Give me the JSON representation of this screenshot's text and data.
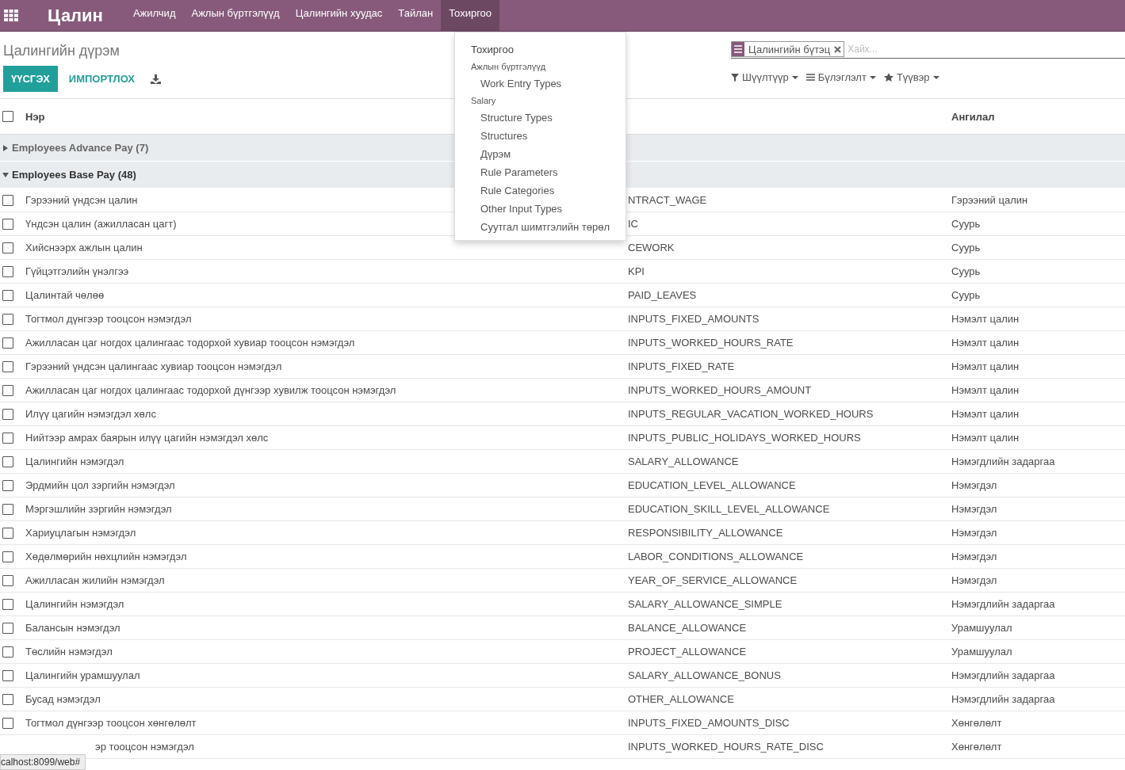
{
  "app_title": "Цалин",
  "nav": [
    {
      "label": "Ажилчид",
      "selected": false
    },
    {
      "label": "Ажлын бүртгэлүүд",
      "selected": false
    },
    {
      "label": "Цалингийн хуудас",
      "selected": false
    },
    {
      "label": "Тайлан",
      "selected": false
    },
    {
      "label": "Тохиргоо",
      "selected": true
    }
  ],
  "menu": [
    {
      "kind": "top",
      "label": "Тохиргоо"
    },
    {
      "kind": "section",
      "label": "Ажлын бүртгэлүүд"
    },
    {
      "kind": "item",
      "label": "Work Entry Types"
    },
    {
      "kind": "section",
      "label": "Salary"
    },
    {
      "kind": "item",
      "label": "Structure Types"
    },
    {
      "kind": "item",
      "label": "Structures"
    },
    {
      "kind": "item",
      "label": "Дүрэм"
    },
    {
      "kind": "item",
      "label": "Rule Parameters"
    },
    {
      "kind": "item",
      "label": "Rule Categories"
    },
    {
      "kind": "item",
      "label": "Other Input Types"
    },
    {
      "kind": "item",
      "label": "Суутгал шимтгэлийн төрөл"
    }
  ],
  "page_title": "Цалингийн дүрэм",
  "buttons": {
    "create": "ҮҮСГЭХ",
    "import": "ИМПОРТЛОХ"
  },
  "search": {
    "facet": "Цалингийн бүтэц",
    "placeholder": "Хайх..."
  },
  "filters": [
    "Шүүлтүүр",
    "Бүлэглэлт",
    "Түүвэр"
  ],
  "table": {
    "all_checked": false,
    "columns": [
      "Нэр",
      "Ангилал"
    ],
    "groups": [
      {
        "label": "Employees Advance Pay (7)",
        "expanded": false
      },
      {
        "label": "Employees Base Pay (48)",
        "expanded": true
      }
    ],
    "rows": [
      {
        "name": "Гэрээний үндсэн цалин",
        "code": "NTRACT_WAGE",
        "category": "Гэрээний цалин",
        "checked": false
      },
      {
        "name": "Үндсэн цалин (ажилласан цагт)",
        "code": "IC",
        "category": "Суурь",
        "checked": false
      },
      {
        "name": "Хийснээрх ажлын цалин",
        "code": "CEWORK",
        "category": "Суурь",
        "checked": false
      },
      {
        "name": "Гүйцэтгэлийн үнэлгээ",
        "code": "KPI",
        "category": "Суурь",
        "checked": false
      },
      {
        "name": "Цалинтай чөлөө",
        "code": "PAID_LEAVES",
        "category": "Суурь",
        "checked": false
      },
      {
        "name": "Тогтмол дүнгээр тооцсон нэмэгдэл",
        "code": "INPUTS_FIXED_AMOUNTS",
        "category": "Нэмэлт цалин",
        "checked": false
      },
      {
        "name": "Ажилласан цаг ногдох цалингаас тодорхой хувиар тооцсон нэмэгдэл",
        "code": "INPUTS_WORKED_HOURS_RATE",
        "category": "Нэмэлт цалин",
        "checked": false
      },
      {
        "name": "Гэрээний үндсэн цалингаас хувиар тооцсон нэмэгдэл",
        "code": "INPUTS_FIXED_RATE",
        "category": "Нэмэлт цалин",
        "checked": false
      },
      {
        "name": "Ажилласан цаг ногдох цалингаас тодорхой дүнгээр хувилж тооцсон нэмэгдэл",
        "code": "INPUTS_WORKED_HOURS_AMOUNT",
        "category": "Нэмэлт цалин",
        "checked": false
      },
      {
        "name": "Илүү цагийн нэмэгдэл хөлс",
        "code": "INPUTS_REGULAR_VACATION_WORKED_HOURS",
        "category": "Нэмэлт цалин",
        "checked": false
      },
      {
        "name": "Нийтээр амрах баярын илүү цагийн нэмэгдэл хөлс",
        "code": "INPUTS_PUBLIC_HOLIDAYS_WORKED_HOURS",
        "category": "Нэмэлт цалин",
        "checked": false
      },
      {
        "name": "Цалингийн нэмэгдэл",
        "code": "SALARY_ALLOWANCE",
        "category": "Нэмэгдлийн задаргаа",
        "checked": false
      },
      {
        "name": "Эрдмийн цол зэргийн нэмэгдэл",
        "code": "EDUCATION_LEVEL_ALLOWANCE",
        "category": "Нэмэгдэл",
        "checked": false
      },
      {
        "name": "Мэргэшлийн зэргийн нэмэгдэл",
        "code": "EDUCATION_SKILL_LEVEL_ALLOWANCE",
        "category": "Нэмэгдэл",
        "checked": false
      },
      {
        "name": "Хариуцлагын нэмэгдэл",
        "code": "RESPONSIBILITY_ALLOWANCE",
        "category": "Нэмэгдэл",
        "checked": false
      },
      {
        "name": "Хөдөлмөрийн нөхцлийн нэмэгдэл",
        "code": "LABOR_CONDITIONS_ALLOWANCE",
        "category": "Нэмэгдэл",
        "checked": false
      },
      {
        "name": "Ажилласан жилийн нэмэгдэл",
        "code": "YEAR_OF_SERVICE_ALLOWANCE",
        "category": "Нэмэгдэл",
        "checked": false
      },
      {
        "name": "Цалингийн нэмэгдэл",
        "code": "SALARY_ALLOWANCE_SIMPLE",
        "category": "Нэмэгдлийн задаргаа",
        "checked": false
      },
      {
        "name": "Балансын нэмэгдэл",
        "code": "BALANCE_ALLOWANCE",
        "category": "Урамшуулал",
        "checked": false
      },
      {
        "name": "Төслийн нэмэгдэл",
        "code": "PROJECT_ALLOWANCE",
        "category": "Урамшуулал",
        "checked": false
      },
      {
        "name": "Цалингийн урамшуулал",
        "code": "SALARY_ALLOWANCE_BONUS",
        "category": "Нэмэгдлийн задаргаа",
        "checked": false
      },
      {
        "name": "Бусад нэмэгдэл",
        "code": "OTHER_ALLOWANCE",
        "category": "Нэмэгдлийн задаргаа",
        "checked": false
      },
      {
        "name": "Тогтмол дүнгээр тооцсон хөнгөлөлт",
        "code": "INPUTS_FIXED_AMOUNTS_DISC",
        "category": "Хөнгөлөлт",
        "checked": false
      },
      {
        "name": "эр тооцсон нэмэгдэл",
        "code": "INPUTS_WORKED_HOURS_RATE_DISC",
        "category": "Хөнгөлөлт"
      }
    ]
  },
  "status_url": "calhost:8099/web#"
}
